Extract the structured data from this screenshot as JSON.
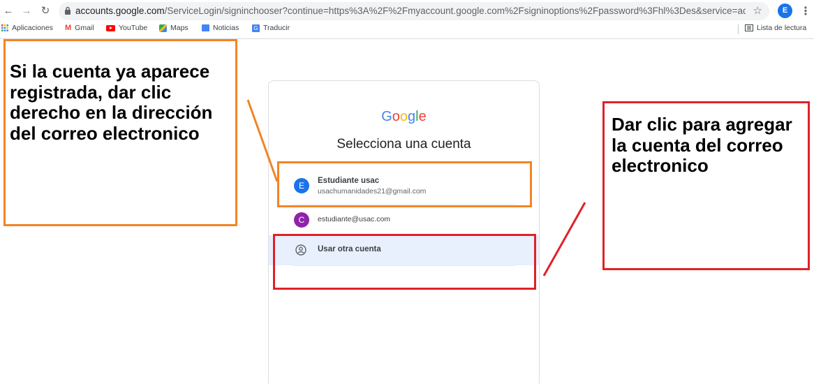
{
  "browser": {
    "url_host": "accounts.google.com",
    "url_path": "/ServiceLogin/signinchooser?continue=https%3A%2F%2Fmyaccount.google.com%2Fsigninoptions%2Fpassword%3Fhl%3Des&service=accountsettings&hl=...",
    "profile_initial": "E",
    "bookmarks": [
      "Aplicaciones",
      "Gmail",
      "YouTube",
      "Maps",
      "Noticias",
      "Traducir"
    ],
    "reading_list": "Lista de lectura"
  },
  "card": {
    "logo": "Google",
    "title": "Selecciona una cuenta",
    "accounts": [
      {
        "initial": "E",
        "name": "Estudiante usac",
        "email": "usachumanidades21@gmail.com",
        "color": "#1a73e8"
      },
      {
        "initial": "C",
        "name": "",
        "email": "estudiante@usac.com",
        "color": "#8e24aa"
      }
    ],
    "other_account": "Usar otra cuenta"
  },
  "annotations": {
    "left": "Si la cuenta ya aparece registrada, dar clic derecho en la dirección del correo electronico",
    "right": "Dar clic para agregar la cuenta del correo electronico"
  }
}
